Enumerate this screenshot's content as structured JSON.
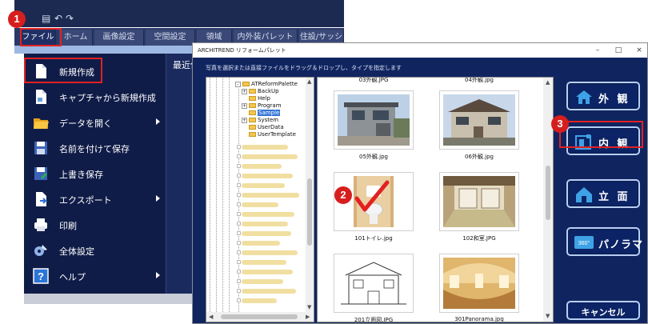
{
  "app": {
    "tabs": [
      "ファイル",
      "ホーム",
      "画像設定",
      "空間設定",
      "領域",
      "内外装パレット",
      "住設/サッシ"
    ],
    "menu_items": [
      {
        "label": "新規作成",
        "icon": "new-document-icon",
        "submenu": false
      },
      {
        "label": "キャプチャから新規作成",
        "icon": "capture-document-icon",
        "submenu": false
      },
      {
        "label": "データを開く",
        "icon": "open-folder-icon",
        "submenu": true
      },
      {
        "label": "名前を付けて保存",
        "icon": "save-as-icon",
        "submenu": false
      },
      {
        "label": "上書き保存",
        "icon": "save-icon",
        "submenu": false
      },
      {
        "label": "エクスポート",
        "icon": "export-icon",
        "submenu": true
      },
      {
        "label": "印刷",
        "icon": "printer-icon",
        "submenu": false
      },
      {
        "label": "全体設定",
        "icon": "settings-icon",
        "submenu": false
      },
      {
        "label": "ヘルプ",
        "icon": "help-icon",
        "submenu": true
      }
    ],
    "recent_label": "最近使用し"
  },
  "dialog": {
    "title": "ARCHITREND リフォームパレット",
    "window_buttons": [
      "–",
      "□",
      "×"
    ],
    "instruction": "写真を選択または直接ファイルをドラッグ＆ドロップし、タイプを指定します",
    "tree": [
      {
        "label": "ATReformPalette",
        "level": 0,
        "expander": "-",
        "selected": false
      },
      {
        "label": "BackUp",
        "level": 1,
        "expander": "+",
        "selected": false
      },
      {
        "label": "Help",
        "level": 1,
        "expander": "",
        "selected": false
      },
      {
        "label": "Program",
        "level": 1,
        "expander": "+",
        "selected": false
      },
      {
        "label": "Sample",
        "level": 1,
        "expander": "",
        "selected": true
      },
      {
        "label": "System",
        "level": 1,
        "expander": "+",
        "selected": false
      },
      {
        "label": "UserData",
        "level": 1,
        "expander": "",
        "selected": false
      },
      {
        "label": "UserTemplate",
        "level": 1,
        "expander": "",
        "selected": false
      }
    ],
    "top_captions": [
      "03外観.JPG",
      "04外観.jpg"
    ],
    "thumbnails": [
      {
        "caption": "05外観.jpg",
        "kind": "exterior-gray"
      },
      {
        "caption": "06外観.jpg",
        "kind": "exterior-brown"
      },
      {
        "caption": "101トイレ.jpg",
        "kind": "toilet"
      },
      {
        "caption": "102和室.JPG",
        "kind": "japanese-room"
      },
      {
        "caption": "201立面図.JPG",
        "kind": "elevation-drawing"
      },
      {
        "caption": "301Panorama.jpg",
        "kind": "panorama"
      }
    ],
    "side_buttons": [
      {
        "label": "外 観",
        "icon": "house-exterior-icon"
      },
      {
        "label": "内 観",
        "icon": "interior-icon"
      },
      {
        "label": "立 面",
        "icon": "elevation-icon"
      },
      {
        "label": "パノラマ",
        "icon": "panorama-360-icon",
        "icon_text": "360°"
      }
    ],
    "cancel_label": "キャンセル"
  },
  "annotations": {
    "step1": "1",
    "step2": "2",
    "step3": "3"
  },
  "colors": {
    "highlight_red": "#e22121",
    "app_navy": "#101c48",
    "dialog_navy": "#102560",
    "button_border": "#b8cff5"
  }
}
